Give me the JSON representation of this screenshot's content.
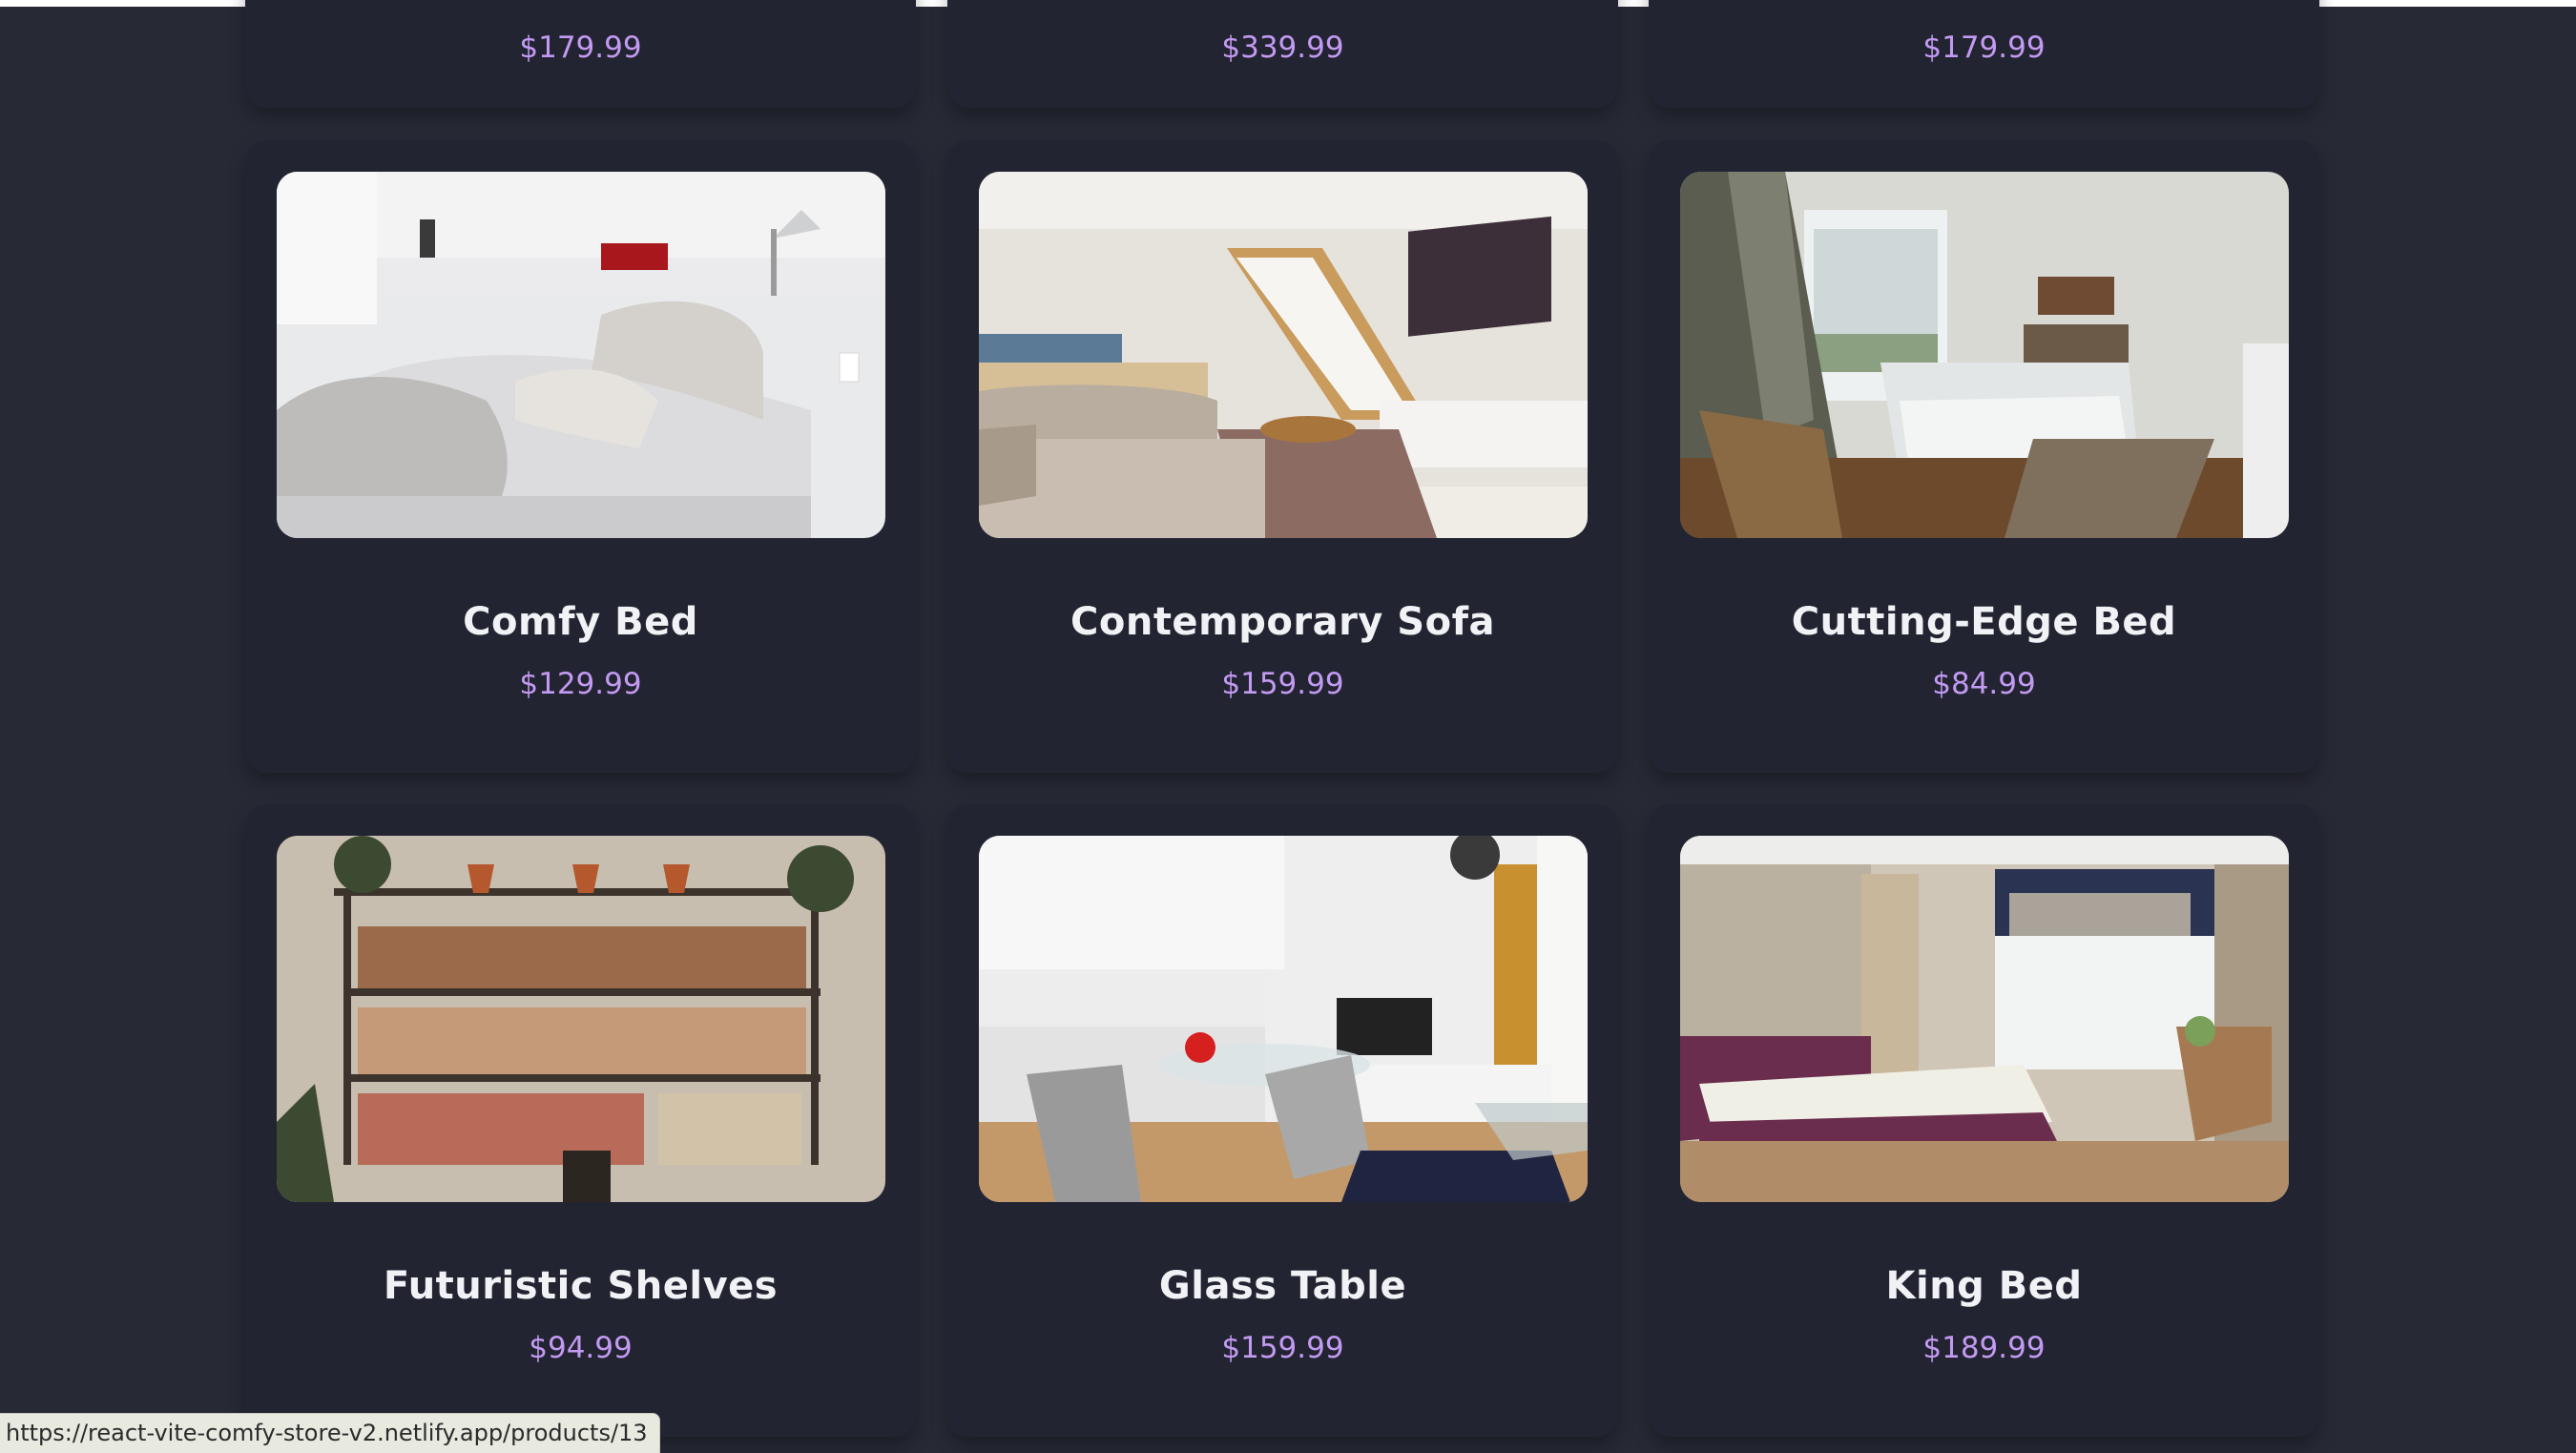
{
  "top_row_prices": [
    "$179.99",
    "$339.99",
    "$179.99"
  ],
  "products": [
    {
      "name": "Comfy Bed",
      "price": "$129.99",
      "image": "bedroom-white-linen"
    },
    {
      "name": "Contemporary Sofa",
      "price": "$159.99",
      "image": "living-room-sofa-stairs"
    },
    {
      "name": "Cutting-Edge Bed",
      "price": "$84.99",
      "image": "bedroom-wood-floor"
    },
    {
      "name": "Futuristic Shelves",
      "price": "$94.99",
      "image": "rustic-bookshelves"
    },
    {
      "name": "Glass Table",
      "price": "$159.99",
      "image": "kitchen-glass-table"
    },
    {
      "name": "King Bed",
      "price": "$189.99",
      "image": "bedroom-purple-bed"
    }
  ],
  "status_bar": {
    "url": "https://react-vite-comfy-store-v2.netlify.app/products/13"
  },
  "colors": {
    "background": "#272935",
    "card": "#222431",
    "title": "#f1f2f5",
    "price": "#c39af2"
  }
}
